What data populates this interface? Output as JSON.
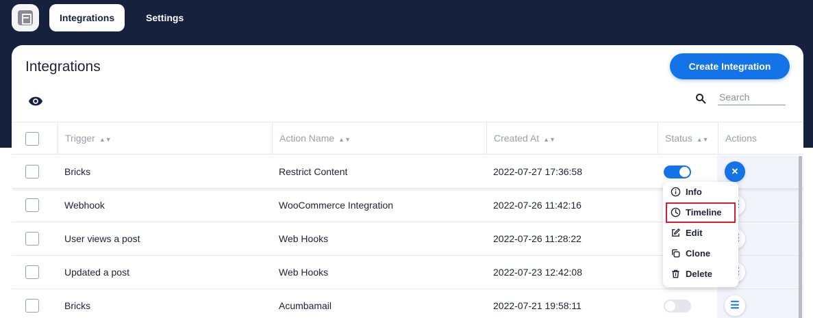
{
  "nav": {
    "tabs": [
      {
        "label": "Integrations",
        "active": true
      },
      {
        "label": "Settings",
        "active": false
      }
    ]
  },
  "page": {
    "title": "Integrations",
    "create_button": "Create Integration",
    "search_placeholder": "Search"
  },
  "table": {
    "columns": [
      "Trigger",
      "Action Name",
      "Created At",
      "Status",
      "Actions"
    ],
    "rows": [
      {
        "trigger": "Bricks",
        "action": "Restrict Content",
        "created": "2022-07-27 17:36:58",
        "status": true
      },
      {
        "trigger": "Webhook",
        "action": "WooCommerce Integration",
        "created": "2022-07-26 11:42:16",
        "status": true
      },
      {
        "trigger": "User views a post",
        "action": "Web Hooks",
        "created": "2022-07-26 11:28:22",
        "status": true
      },
      {
        "trigger": "Updated a post",
        "action": "Web Hooks",
        "created": "2022-07-23 12:42:08",
        "status": true
      },
      {
        "trigger": "Bricks",
        "action": "Acumbamail",
        "created": "2022-07-21 19:58:11",
        "status": false
      }
    ]
  },
  "action_menu": {
    "items": [
      {
        "label": "Info",
        "icon": "info-icon"
      },
      {
        "label": "Timeline",
        "icon": "clock-icon",
        "highlighted": true
      },
      {
        "label": "Edit",
        "icon": "edit-icon"
      },
      {
        "label": "Clone",
        "icon": "clone-icon"
      },
      {
        "label": "Delete",
        "icon": "trash-icon"
      }
    ]
  },
  "colors": {
    "header_bg": "#16213e",
    "accent": "#1473e6",
    "highlight_border": "#e0182d"
  }
}
